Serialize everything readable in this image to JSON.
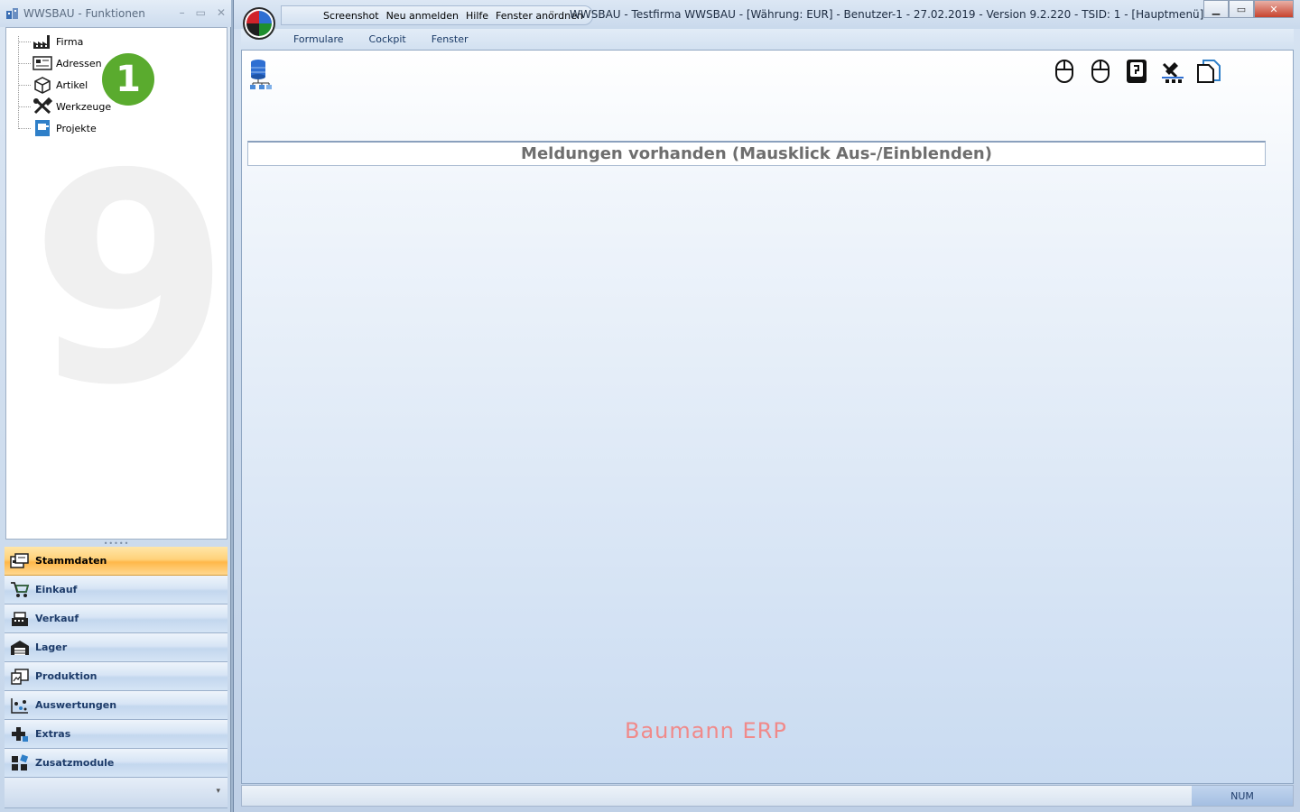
{
  "left_window": {
    "title": "WWSBAU - Funktionen",
    "controls": [
      "–",
      "▭",
      "✕"
    ],
    "tree": [
      {
        "label": "Firma",
        "icon": "factory-icon"
      },
      {
        "label": "Adressen",
        "icon": "address-card-icon"
      },
      {
        "label": "Artikel",
        "icon": "box-icon"
      },
      {
        "label": "Werkzeuge",
        "icon": "tools-icon"
      },
      {
        "label": "Projekte",
        "icon": "project-icon"
      }
    ],
    "badge": "1",
    "watermark": "9",
    "nav": [
      {
        "label": "Stammdaten",
        "icon": "master-data-icon",
        "active": true
      },
      {
        "label": "Einkauf",
        "icon": "cart-icon",
        "active": false
      },
      {
        "label": "Verkauf",
        "icon": "cash-register-icon",
        "active": false
      },
      {
        "label": "Lager",
        "icon": "warehouse-icon",
        "active": false
      },
      {
        "label": "Produktion",
        "icon": "production-icon",
        "active": false
      },
      {
        "label": "Auswertungen",
        "icon": "analysis-icon",
        "active": false
      },
      {
        "label": "Extras",
        "icon": "extras-icon",
        "active": false
      },
      {
        "label": "Zusatzmodule",
        "icon": "modules-icon",
        "active": false
      }
    ]
  },
  "main_window": {
    "quick_access": [
      "Screenshot",
      "Neu anmelden",
      "Hilfe",
      "Fenster anordnen"
    ],
    "title": "WWSBAU - Testfirma WWSBAU - [Währung: EUR] - Benutzer-1 - 27.02.2019 - Version 9.2.220 - TSID: 1 - [Hauptmenü]",
    "menu_tabs": [
      "Formulare",
      "Cockpit",
      "Fenster"
    ],
    "messages_bar": "Meldungen vorhanden  (Mausklick Aus-/Einblenden)",
    "brand": "Baumann ERP",
    "status_num": "NUM"
  },
  "colors": {
    "active_nav": "#ffb84a",
    "badge": "#5aab2e",
    "brand_text": "#f08a8a",
    "close_button": "#c7432d"
  }
}
